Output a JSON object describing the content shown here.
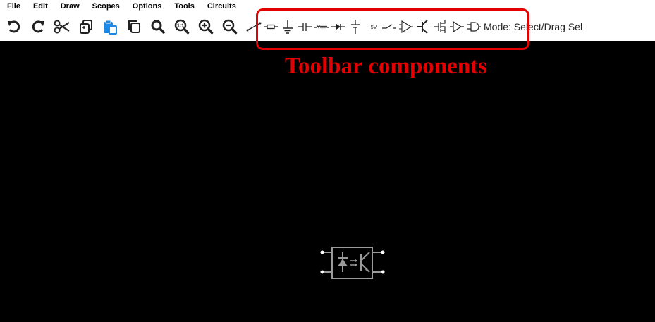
{
  "menu": {
    "items": [
      "File",
      "Edit",
      "Draw",
      "Scopes",
      "Options",
      "Tools",
      "Circuits"
    ]
  },
  "toolbar": {
    "actions": [
      "undo-icon",
      "redo-icon",
      "cut-icon",
      "copy-icon",
      "paste-icon",
      "duplicate-icon",
      "zoom-search-icon",
      "zoom-100-icon",
      "zoom-in-icon",
      "zoom-out-icon"
    ],
    "zoom_100_label": "1:1",
    "components": [
      "wire-icon",
      "resistor-icon",
      "ground-icon",
      "capacitor-icon",
      "inductor-icon",
      "diode-icon",
      "voltage-source-icon",
      "rail-plus5v-icon",
      "switch-icon",
      "opamp-icon",
      "npn-transistor-icon",
      "mosfet-icon",
      "buffer-icon",
      "logic-gate-icon"
    ],
    "rail_label": "+5V",
    "mode_text": "Mode: Select/Drag Sel"
  },
  "annotation": {
    "label": "Toolbar components",
    "color": "#e40000"
  },
  "canvas": {
    "background": "#000000",
    "element_color": "#9a9a9a",
    "element_icon": "optocoupler-icon"
  }
}
